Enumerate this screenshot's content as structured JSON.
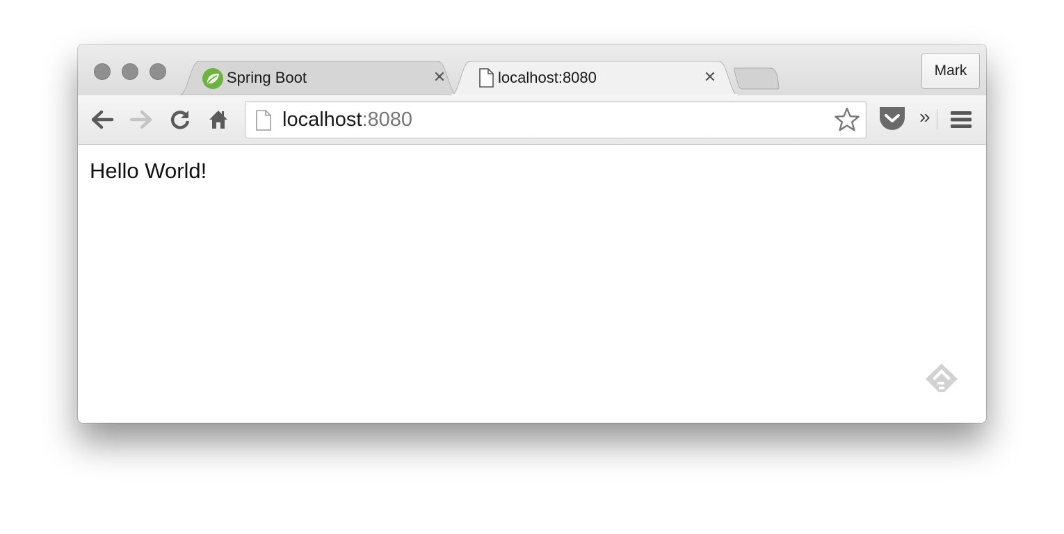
{
  "tabs": [
    {
      "title": "Spring Boot",
      "active": false,
      "favicon": "spring-leaf-icon"
    },
    {
      "title": "localhost:8080",
      "active": true,
      "favicon": "page-icon"
    }
  ],
  "profile": {
    "name": "Mark"
  },
  "address_bar": {
    "host": "localhost",
    "port": ":8080"
  },
  "page": {
    "text": "Hello World!"
  },
  "colors": {
    "spring_green": "#6db33f",
    "traffic_light": "#8f8f8f",
    "feedly_gray": "#d2d2d2"
  }
}
